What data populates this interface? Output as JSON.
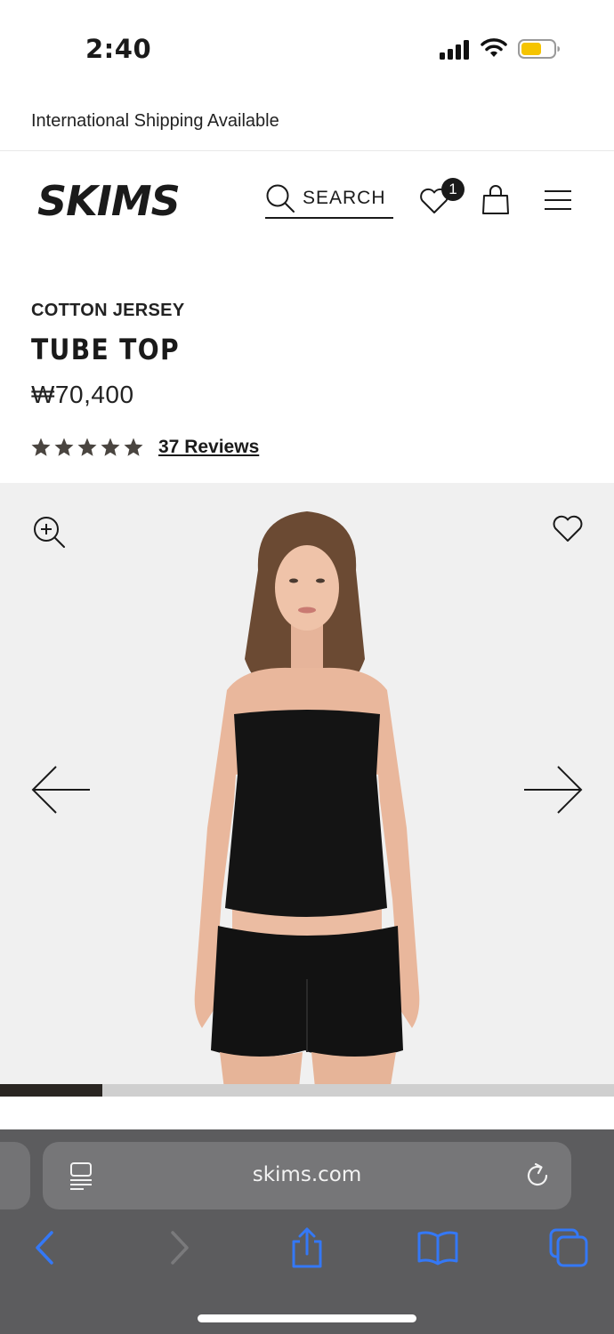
{
  "status_bar": {
    "time": "2:40"
  },
  "promo": {
    "text": "International Shipping Available"
  },
  "header": {
    "logo_text": "SKIMS",
    "search_label": "SEARCH",
    "wishlist_count": "1"
  },
  "product": {
    "collection": "COTTON JERSEY",
    "title": "TUBE TOP",
    "price": "₩70,400",
    "rating": 5,
    "reviews_label": "37 Reviews"
  },
  "gallery": {
    "progress": 0.167
  },
  "safari": {
    "url": "skims.com"
  },
  "colors": {
    "text": "#1a1a1a",
    "star": "#4a4540",
    "safari_bg": "#5c5c5e",
    "ios_blue": "#3478f6",
    "battery": "#f5c400"
  }
}
